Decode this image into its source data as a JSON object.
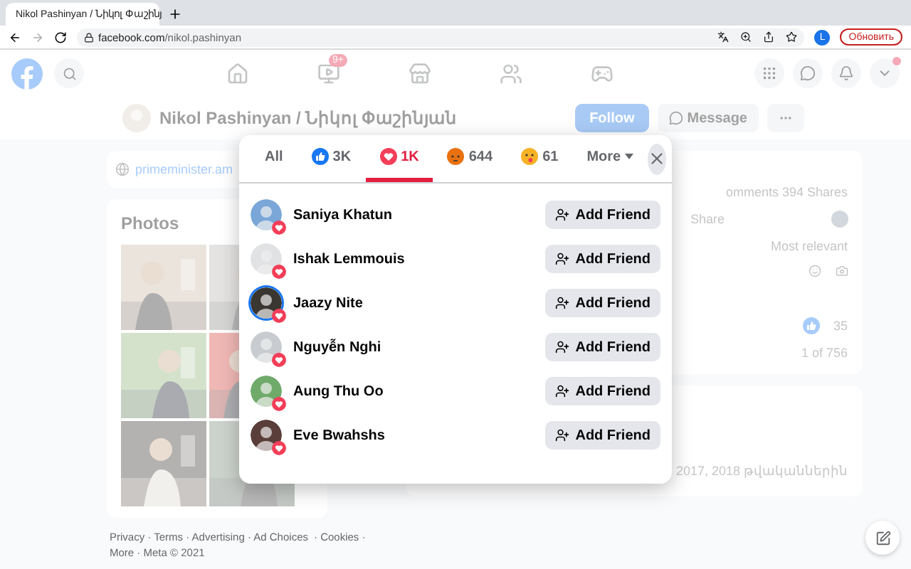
{
  "browser": {
    "tab_title": "Nikol Pashinyan / Նիկոլ Փաշինյ",
    "url_host": "facebook.com",
    "url_path": "/nikol.pashinyan",
    "profile_initial": "L",
    "update_button": "Обновить"
  },
  "nav": {
    "video_badge": "9+"
  },
  "profile": {
    "name": "Nikol Pashinyan / Նիկոլ Փաշինյան",
    "follow": "Follow",
    "message": "Message"
  },
  "intro": {
    "website": "primeminister.am"
  },
  "photos": {
    "title": "Photos"
  },
  "footer": {
    "line_1": "Privacy · Terms · Advertising · Ad Choices",
    "line_1_end": "· Cookies ·",
    "line_2": "More · Meta © 2021"
  },
  "post": {
    "stats": "omments  394 Shares",
    "share": "Share",
    "sort": "Most relevant",
    "reaction_count": "35",
    "pager": "1 of 756"
  },
  "post2": {
    "line": "2017, 2018 թվականներին"
  },
  "reactions": {
    "tabs": [
      {
        "kind": "all",
        "label": "All",
        "selected": false
      },
      {
        "kind": "like",
        "label": "3K",
        "selected": false
      },
      {
        "kind": "love",
        "label": "1K",
        "selected": true
      },
      {
        "kind": "angry",
        "label": "644",
        "selected": false
      },
      {
        "kind": "care",
        "label": "61",
        "selected": false
      },
      {
        "kind": "more",
        "label": "More",
        "selected": false
      }
    ],
    "people": [
      {
        "name": "Saniya Khatun",
        "button": "Add Friend",
        "story": false
      },
      {
        "name": "Ishak Lemmouis",
        "button": "Add Friend",
        "story": false
      },
      {
        "name": "Jaazy Nite",
        "button": "Add Friend",
        "story": true
      },
      {
        "name": "Nguyễn Nghi",
        "button": "Add Friend",
        "story": false
      },
      {
        "name": "Aung Thu Oo",
        "button": "Add Friend",
        "story": false
      },
      {
        "name": "Eve Bwahshs",
        "button": "Add Friend",
        "story": false
      }
    ]
  }
}
